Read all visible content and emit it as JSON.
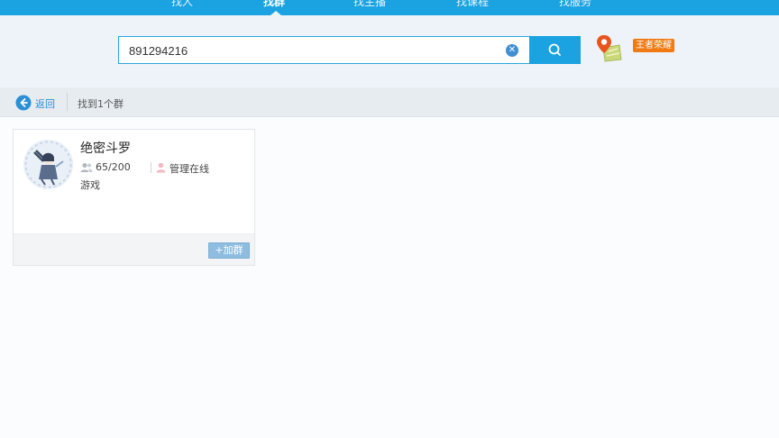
{
  "top_tabs": [
    {
      "label": "找人",
      "active": false
    },
    {
      "label": "找群",
      "active": true
    },
    {
      "label": "找主播",
      "active": false
    },
    {
      "label": "找课程",
      "active": false
    },
    {
      "label": "找服务",
      "active": false
    }
  ],
  "search": {
    "value": "891294216",
    "clear_icon": "clear-icon",
    "button_icon": "search-icon"
  },
  "location": {
    "icon": "map-pin-icon",
    "badge": "王者荣耀",
    "badge_color": "#f07b15"
  },
  "nav": {
    "back_label": "返回",
    "result_text": "找到1个群"
  },
  "results": [
    {
      "name": "绝密斗罗",
      "members": "65/200",
      "admin_status": "管理在线",
      "tag": "游戏",
      "join_label": "+加群"
    }
  ],
  "colors": {
    "accent": "#1ba2e0",
    "link": "#2a8fd6",
    "join_button": "#8ebddf"
  }
}
